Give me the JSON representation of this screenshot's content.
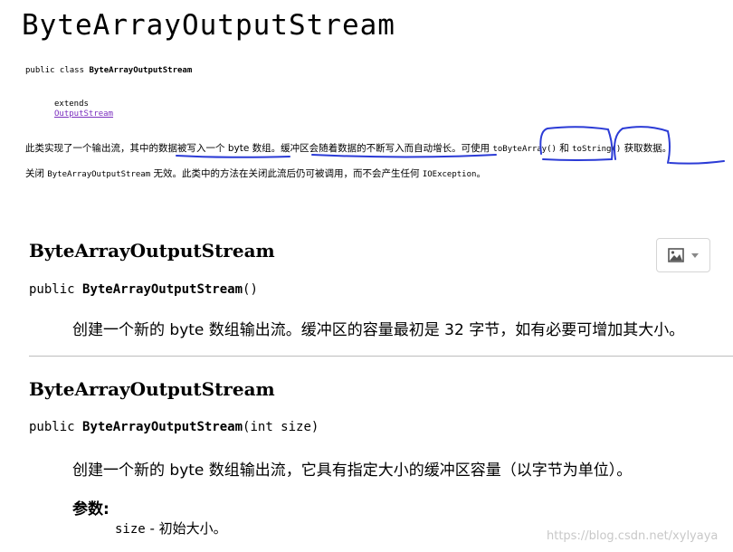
{
  "title": "ByteArrayOutputStream",
  "class_decl": {
    "prefix": "public class ",
    "name": "ByteArrayOutputStream"
  },
  "extends_kw": "extends",
  "extends_link": "OutputStream",
  "description": {
    "line1_a": "此类实现了一个输出流，其中的数据被写入一个 byte 数组。缓冲区会随着数据的不断写入而自动增长。可使用 ",
    "line1_code1": "toByteArray()",
    "line1_b": " 和 ",
    "line1_code2": "toString()",
    "line1_c": " 获取数据。",
    "line2_a": "关闭 ",
    "line2_code": "ByteArrayOutputStream",
    "line2_b": " 无效。此类中的方法在关闭此流后仍可被调用，而不会产生任何 ",
    "line2_code2": "IOException",
    "line2_c": "。"
  },
  "constructors": [
    {
      "title": "ByteArrayOutputStream",
      "sig_prefix": "public ",
      "sig_name": "ByteArrayOutputStream",
      "sig_params": "()",
      "desc": "创建一个新的 byte 数组输出流。缓冲区的容量最初是 32 字节，如有必要可增加其大小。"
    },
    {
      "title": "ByteArrayOutputStream",
      "sig_prefix": "public ",
      "sig_name": "ByteArrayOutputStream",
      "sig_params": "(int size)",
      "desc": "创建一个新的 byte 数组输出流，它具有指定大小的缓冲区容量（以字节为单位）。"
    }
  ],
  "params_label": "参数:",
  "param": {
    "name": "size",
    "desc": " - 初始大小。"
  },
  "watermark": "https://blog.csdn.net/xylyaya",
  "colors": {
    "link": "#7b2fbe",
    "annotation": "#2b3bd6"
  },
  "icons": {
    "image_button": "image-icon",
    "dropdown": "caret-down-icon"
  }
}
